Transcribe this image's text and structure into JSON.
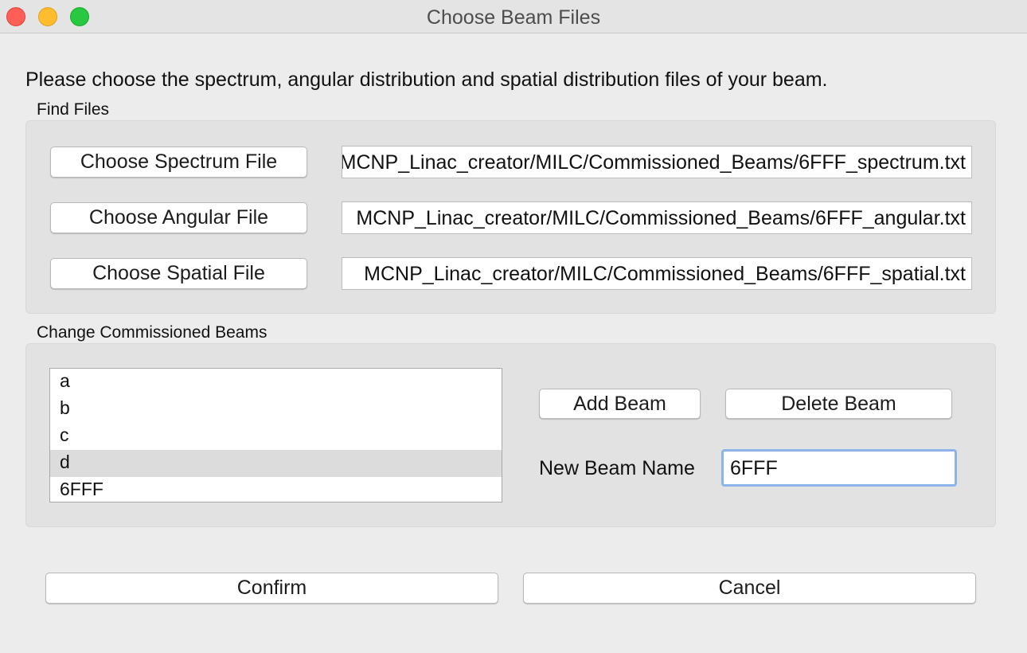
{
  "window": {
    "title": "Choose Beam Files"
  },
  "instructions": "Please choose the spectrum, angular distribution and spatial distribution files of your beam.",
  "find_files": {
    "label": "Find Files",
    "rows": [
      {
        "button": "Choose Spectrum File",
        "path": "MCNP_Linac_creator/MILC/Commissioned_Beams/6FFF_spectrum.txt"
      },
      {
        "button": "Choose Angular File",
        "path": "MCNP_Linac_creator/MILC/Commissioned_Beams/6FFF_angular.txt"
      },
      {
        "button": "Choose Spatial File",
        "path": "MCNP_Linac_creator/MILC/Commissioned_Beams/6FFF_spatial.txt"
      }
    ]
  },
  "commissioned": {
    "label": "Change Commissioned Beams",
    "beams": [
      "a",
      "b",
      "c",
      "d",
      "6FFF"
    ],
    "selected": "d",
    "add_label": "Add Beam",
    "delete_label": "Delete Beam",
    "new_name_label": "New Beam Name",
    "new_name_value": "6FFF"
  },
  "footer": {
    "confirm": "Confirm",
    "cancel": "Cancel"
  },
  "colors": {
    "close": "#ff5f57",
    "minimize": "#febc2e",
    "maximize": "#28c840",
    "focus_ring": "#8eb3ea",
    "selection": "#dcdcdc"
  }
}
